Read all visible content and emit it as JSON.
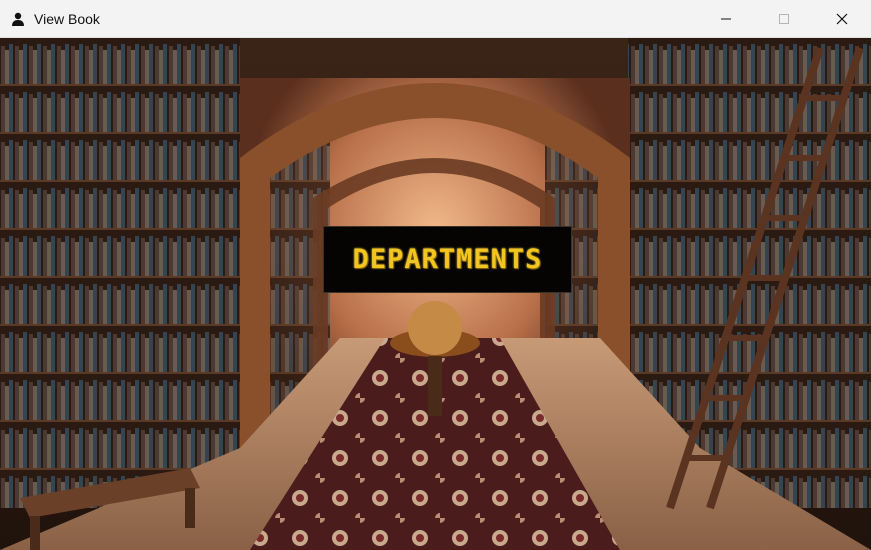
{
  "window": {
    "title": "View Book",
    "controls": {
      "minimize": "minimize",
      "maximize": "maximize",
      "close": "close"
    }
  },
  "scene": {
    "button_label": "DEPARTMENTS",
    "colors": {
      "button_text": "#f3c521",
      "button_bg": "#050403"
    }
  }
}
